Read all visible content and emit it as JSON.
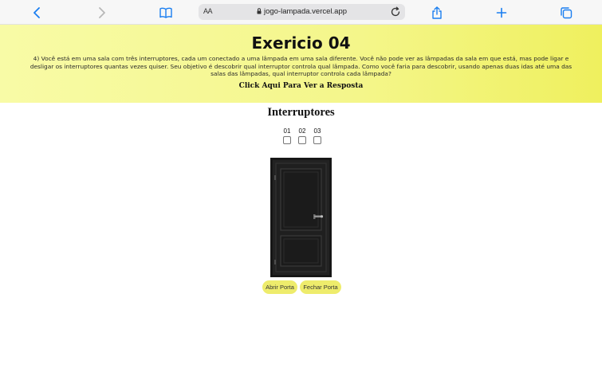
{
  "browser": {
    "text_size_label": "AA",
    "url": "jogo-lampada.vercel.app",
    "icons": [
      "back-icon",
      "forward-icon",
      "bookmarks-icon",
      "lock-icon",
      "reload-icon",
      "share-icon",
      "new-tab-icon",
      "tabs-icon"
    ]
  },
  "header": {
    "title": "Exericio 04",
    "description": "4) Você está em uma sala com três interruptores, cada um conectado a uma lâmpada em uma sala diferente. Você não pode ver as lâmpadas da sala em que está, mas pode ligar e desligar os interruptores quantas vezes quiser. Seu objetivo é descobrir qual interruptor controla qual lâmpada. Como você faria para descobrir, usando apenas duas idas até uma das salas das lâmpadas, qual interruptor controla cada lâmpada?",
    "answer_link": "Click Aqui Para Ver a Resposta",
    "gradient_colors": [
      "#f8fba6",
      "#eff05e"
    ]
  },
  "switches": {
    "title": "Interruptores",
    "items": [
      {
        "label": "01",
        "checked": false
      },
      {
        "label": "02",
        "checked": false
      },
      {
        "label": "03",
        "checked": false
      }
    ]
  },
  "door": {
    "state": "closed",
    "color": "#1c1c1c"
  },
  "buttons": {
    "open_label": "Abrir Porta",
    "close_label": "Fechar Porta",
    "color": "#eeec6c"
  }
}
